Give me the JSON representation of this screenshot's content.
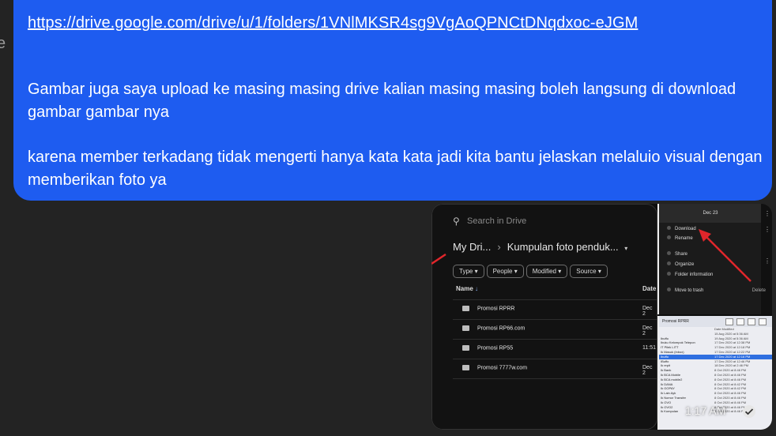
{
  "message": {
    "link": "https://drive.google.com/drive/u/1/folders/1VNlMKSR4sg9VgAoQPNCtDNqdxoc-eJGM",
    "paragraph1": "Gambar juga saya upload ke masing masing drive kalian masing masing boleh langsung di download gambar gambar nya",
    "paragraph2": "karena member terkadang tidak mengerti hanya kata kata jadi kita bantu jelaskan melaluio visual dengan memberikan foto ya"
  },
  "photo": {
    "drive": {
      "search_placeholder": "Search in Drive",
      "breadcrumb_root": "My Dri...",
      "breadcrumb_current": "Kumpulan foto penduk...",
      "chips": [
        "Type",
        "People",
        "Modified",
        "Source"
      ],
      "col_name": "Name",
      "col_date": "Date",
      "folders": [
        {
          "name": "Promosi RPRR",
          "date": "Dec 2"
        },
        {
          "name": "Promosi RP66.com",
          "date": "Dec 2"
        },
        {
          "name": "Promosi RP55",
          "date": "11:51"
        },
        {
          "name": "Promosi 7777w.com",
          "date": "Dec 2"
        }
      ]
    },
    "menu": {
      "title": "Dec 23",
      "items": [
        "Download",
        "Rename",
        "Share",
        "Organize",
        "Folder information",
        "Move to trash"
      ],
      "side_delete": "Delete"
    },
    "files": {
      "title": "Promosi RPRR",
      "header": "Date Modified",
      "rows": [
        {
          "n": "",
          "d": "15 Aug 2020 at 5:36 AM"
        },
        {
          "n": "Ibuffo",
          "d": "19 Aug 2020 at 5:36 AM"
        },
        {
          "n": "Ibuku Kelompok Telepon",
          "d": "17 Dec 2020 at 12:38 PM"
        },
        {
          "n": "IT Pilek LITT",
          "d": "17 Dec 2020 at 12:18 PM"
        },
        {
          "n": "Ik Masuk (Inbox)",
          "d": "17 Dec 2020 at 12:22 PM"
        },
        {
          "n": "Ibuffo",
          "d": "17 Dec 2020 at 12:16 PM"
        },
        {
          "n": "IBuffo",
          "d": "17 Dec 2020 at 12:46 PM"
        },
        {
          "n": "Ik repit",
          "d": "18 Dec 2020 at 2:46 PM"
        },
        {
          "n": "Ik Bank",
          "d": "8 Oct 2020 at 8:46 PM"
        },
        {
          "n": "Ik BCA Mobile",
          "d": "8 Oct 2020 at 8:46 PM"
        },
        {
          "n": "Ik BCA mobile2",
          "d": "8 Oct 2020 at 8:46 PM"
        },
        {
          "n": "Ik DANA",
          "d": "8 Oct 2020 at 8:42 PM"
        },
        {
          "n": "Ik GOPAY",
          "d": "8 Oct 2020 at 8:42 PM"
        },
        {
          "n": "Ik Lain Ayk",
          "d": "8 Oct 2020 at 8:46 PM"
        },
        {
          "n": "Ik Nomor Transfer",
          "d": "8 Oct 2020 at 8:46 PM"
        },
        {
          "n": "Ik OVO",
          "d": "8 Oct 2020 at 8:46 PM"
        },
        {
          "n": "Ik OVO2",
          "d": "8 Oct 2020 at 8:46 PM"
        },
        {
          "n": "Ik Kumpulan",
          "d": "8 Oct 2020 at 8:46 PM"
        }
      ]
    }
  },
  "time": "1:17 AM",
  "colors": {
    "bubble": "#1e5cf0",
    "arrow": "#e0262b"
  }
}
